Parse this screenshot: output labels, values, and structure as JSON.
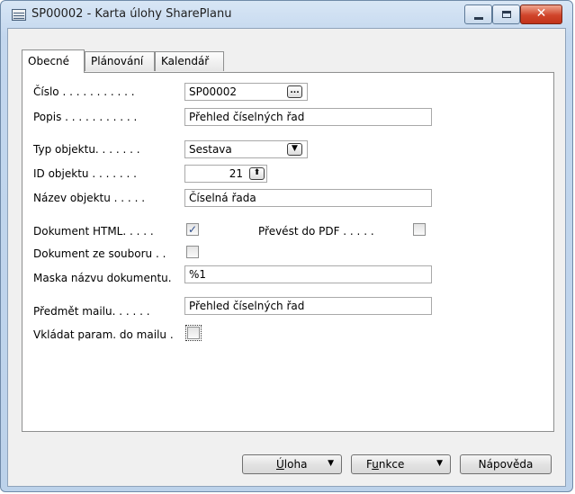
{
  "window": {
    "title": "SP00002 - Karta úlohy SharePlanu",
    "close_glyph": "✕"
  },
  "tabs": [
    {
      "label": "Obecné",
      "active": true
    },
    {
      "label": "Plánování",
      "active": false
    },
    {
      "label": "Kalendář",
      "active": false
    }
  ],
  "fields": {
    "cislo": {
      "label": "Číslo . . . . . . . . . . .",
      "value": "SP00002",
      "assist": "..."
    },
    "popis": {
      "label": "Popis . . . . . . . . . . .",
      "value": "Přehled číselných řad"
    },
    "typ_objektu": {
      "label": "Typ objektu. . . . . . .",
      "value": "Sestava",
      "dropdown_glyph": "▼"
    },
    "id_objektu": {
      "label": "ID objektu . . . . . . .",
      "value": "21",
      "lookup_glyph": "⬆"
    },
    "nazev_objektu": {
      "label": "Název objektu . . . . .",
      "value": "Číselná řada"
    },
    "dokument_html": {
      "label": "Dokument HTML. . . . .",
      "checked": true,
      "check_glyph": "✓"
    },
    "prevest_do_pdf": {
      "label": "Převést do PDF . . . . .",
      "checked": false
    },
    "dokument_ze_souboru": {
      "label": "Dokument ze souboru . .",
      "checked": false
    },
    "maska_nazvu": {
      "label": "Maska názvu dokumentu.",
      "value": "%1"
    },
    "predmet_mailu": {
      "label": "Předmět mailu. . . . . .",
      "value": "Přehled číselných řad"
    },
    "vkladat_param": {
      "label": "Vkládat param. do mailu .",
      "checked": false
    }
  },
  "buttons": {
    "uloha": {
      "label_first": "Ú",
      "label_rest": "loha",
      "arrow": "▼"
    },
    "funkce": {
      "label_first": "F",
      "label_underlined": "u",
      "label_rest": "nkce",
      "arrow": "▼"
    },
    "napoveda": {
      "label": "Nápověda"
    }
  },
  "colors": {
    "accent": "#3d6fb5",
    "close_button": "#c2331a"
  }
}
